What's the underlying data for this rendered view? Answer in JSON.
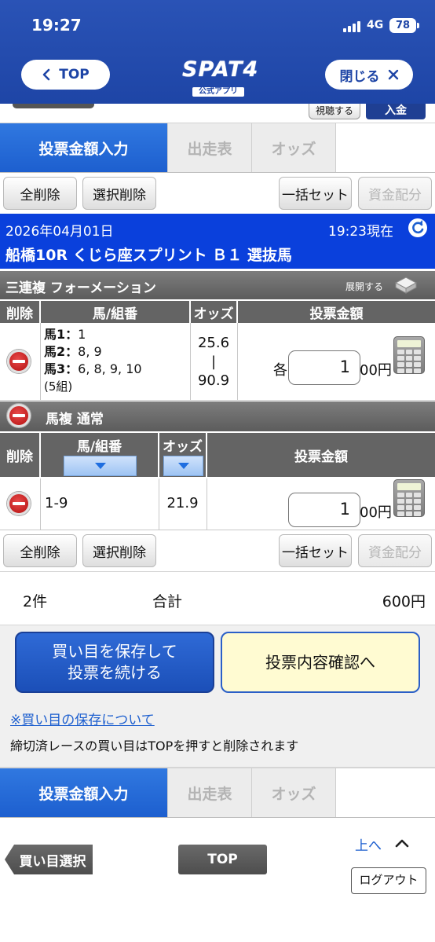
{
  "status": {
    "time": "19:27",
    "network": "4G",
    "battery": "78"
  },
  "header": {
    "top_label": "TOP",
    "close_label": "閉じる",
    "logo_text": "SPAT4",
    "logo_sub": "公式アプリ"
  },
  "peek": {
    "listen_label": "視聴する",
    "deposit_label": "入金"
  },
  "tabs": [
    {
      "label": "投票金額入力",
      "active": true
    },
    {
      "label": "出走表",
      "active": false
    },
    {
      "label": "オッズ",
      "active": false
    }
  ],
  "toolbar": {
    "delete_all": "全削除",
    "delete_selected": "選択削除",
    "bulk_set": "一括セット",
    "fund_allocate": "資金配分"
  },
  "race": {
    "date": "2026年04月01日",
    "as_of": "19:23現在",
    "title": "船橋10R くじら座スプリント Ｂ１ 選抜馬"
  },
  "bet1": {
    "type": "三連複 フォーメーション",
    "expand_label": "展開する",
    "headers": {
      "delete": "削除",
      "combo": "馬/組番",
      "odds": "オッズ",
      "amount": "投票金額"
    },
    "combo_lines": [
      {
        "label": "馬1：",
        "value": "1"
      },
      {
        "label": "馬2：",
        "value": "8, 9"
      },
      {
        "label": "馬3：",
        "value": "6, 8, 9, 10"
      }
    ],
    "combo_count": "(5組)",
    "odds_low": "25.6",
    "odds_sep": "|",
    "odds_high": "90.9",
    "each_label": "各",
    "amount": "1",
    "unit": "00円"
  },
  "bet2": {
    "type": "馬複 通常",
    "headers": {
      "delete": "削除",
      "combo": "馬/組番",
      "odds": "オッズ",
      "amount": "投票金額"
    },
    "combo": "1-9",
    "odds": "21.9",
    "amount": "1",
    "unit": "00円"
  },
  "summary": {
    "count": "2件",
    "total_label": "合計",
    "total": "600円"
  },
  "actions": {
    "save_line1": "買い目を保存して",
    "save_line2": "投票を続ける",
    "confirm": "投票内容確認へ"
  },
  "notes": {
    "save_link": "※買い目の保存について",
    "info": "締切済レースの買い目はTOPを押すと削除されます"
  },
  "footer": {
    "back_label": "買い目選択",
    "top_label": "TOP",
    "up_label": "上へ",
    "logout_label": "ログアウト"
  },
  "colors": {
    "header_blue": "#1e45a6",
    "tab_active": "#1d5fcf",
    "race_bar": "#0a40dc",
    "confirm_bg": "#fffbd2",
    "save_bg": "#1e56c4"
  }
}
